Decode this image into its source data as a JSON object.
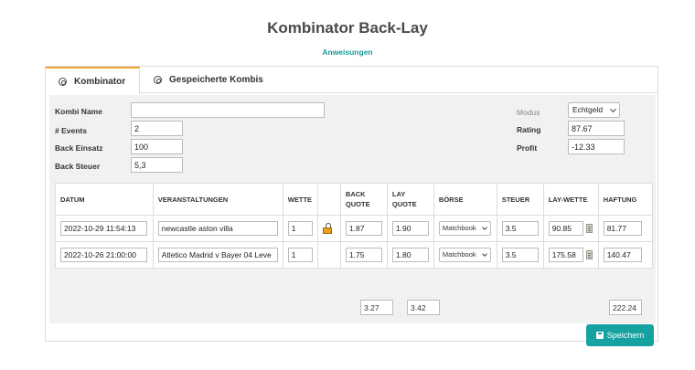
{
  "page": {
    "title": "Kombinator Back-Lay",
    "instructions_link": "Anweisungen"
  },
  "tabs": [
    {
      "label": "Kombinator",
      "icon": "settings-icon",
      "active": true
    },
    {
      "label": "Gespeicherte Kombis",
      "icon": "dribbble-icon",
      "active": false
    }
  ],
  "form": {
    "kombi_name": {
      "label": "Kombi Name",
      "value": ""
    },
    "events": {
      "label": "# Events",
      "value": "2"
    },
    "back_einsatz": {
      "label": "Back Einsatz",
      "value": "100"
    },
    "back_steuer": {
      "label": "Back Steuer",
      "value": "5,3"
    }
  },
  "summary": {
    "modus": {
      "label": "Modus",
      "value": "Echtgeld"
    },
    "rating": {
      "label": "Rating",
      "value": "87.67"
    },
    "profit": {
      "label": "Profit",
      "value": "-12.33"
    }
  },
  "table": {
    "headers": {
      "datum": "DATUM",
      "veranstaltungen": "VERANSTALTUNGEN",
      "wette": "WETTE",
      "lock": "",
      "back_quote_1": "BACK",
      "back_quote_2": "QUOTE",
      "lay_quote_1": "LAY",
      "lay_quote_2": "QUOTE",
      "boerse": "BÖRSE",
      "steuer": "STEUER",
      "lay_wette": "LAY-WETTE",
      "haftung": "HAFTUNG"
    },
    "rows": [
      {
        "datum": "2022-10-29 11:54:13",
        "event": "newcastle aston villa",
        "wette": "1",
        "back": "1.87",
        "lay": "1.90",
        "boerse": "Matchbook",
        "steuer": "3.5",
        "lay_wette": "90.85",
        "haftung": "81.77",
        "locked": true
      },
      {
        "datum": "2022-10-26 21:00:00",
        "event": "Atletico Madrid v Bayer 04 Leve",
        "wette": "1",
        "back": "1.75",
        "lay": "1.80",
        "boerse": "Matchbook",
        "steuer": "3.5",
        "lay_wette": "175.58",
        "haftung": "140.47",
        "locked": false
      }
    ],
    "totals": {
      "back": "3.27",
      "lay": "3.42",
      "haftung": "222.24"
    }
  },
  "buttons": {
    "save": "Speichern"
  }
}
